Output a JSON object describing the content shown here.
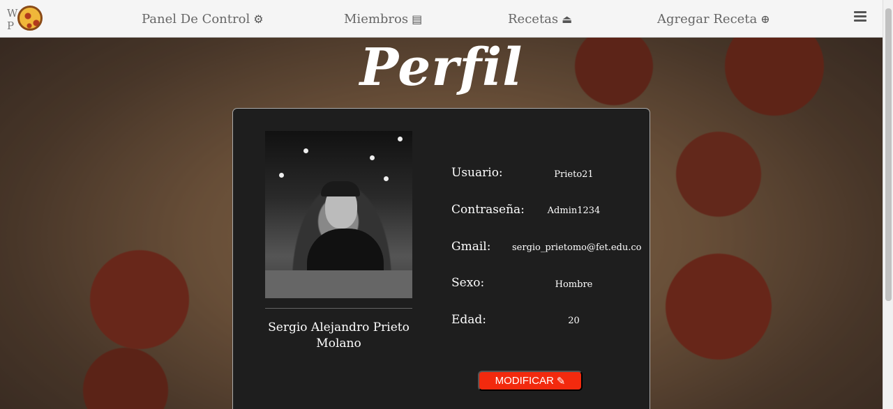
{
  "navbar": {
    "logo_text": "W        P",
    "items": [
      {
        "label": "Panel De Control",
        "icon": "⚙"
      },
      {
        "label": "Miembros",
        "icon": "▤"
      },
      {
        "label": "Recetas",
        "icon": "⏏"
      },
      {
        "label": "Agregar Receta",
        "icon": "⊕"
      }
    ],
    "menu_icon": "hamburger-menu-icon"
  },
  "page": {
    "title": "Perfil"
  },
  "profile": {
    "name": "Sergio Alejandro Prieto Molano",
    "fields": [
      {
        "label": "Usuario:",
        "value": "Prieto21"
      },
      {
        "label": "Contraseña:",
        "value": "Admin1234"
      },
      {
        "label": "Gmail:",
        "value": "sergio_prietomo@fet.edu.co"
      },
      {
        "label": "Sexo:",
        "value": "Hombre"
      },
      {
        "label": "Edad:",
        "value": "20"
      }
    ],
    "modify_label": "MODIFICAR",
    "modify_icon": "✎"
  },
  "colors": {
    "accent": "#f22a0e",
    "card_bg": "#1e1e1e",
    "navbar_bg": "#f5f5f5"
  }
}
